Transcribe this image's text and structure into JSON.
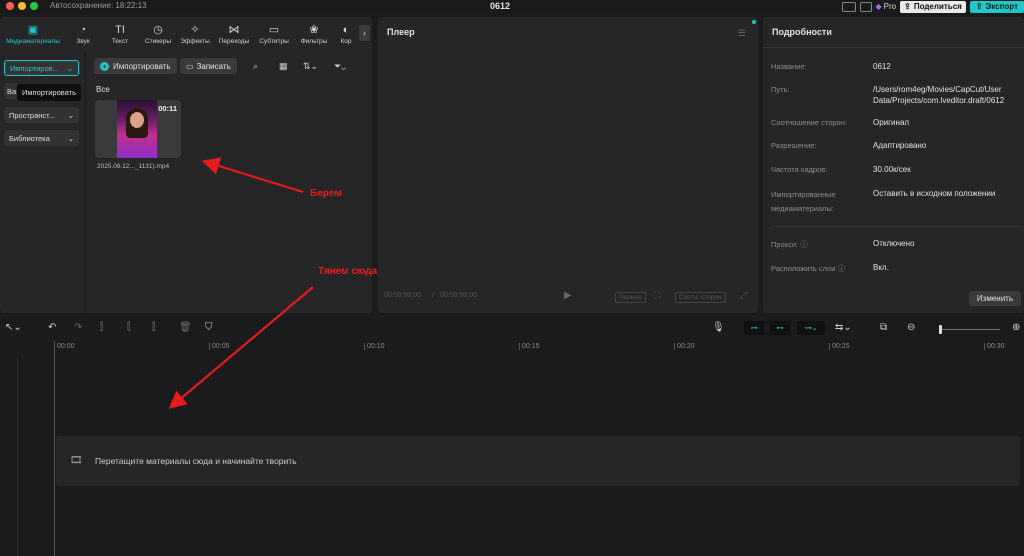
{
  "titlebar": {
    "autosave": "Автосохранение: 18:22:13",
    "project": "0612",
    "pro": "Pro",
    "share": "Поделиться",
    "export": "Экспорт"
  },
  "tabs": [
    {
      "label": "Медиаматериалы",
      "icon": "media-icon",
      "glyph": "▣"
    },
    {
      "label": "Звук",
      "icon": "audio-icon",
      "glyph": "◔"
    },
    {
      "label": "Текст",
      "icon": "text-icon",
      "glyph": "TI"
    },
    {
      "label": "Стикеры",
      "icon": "sticker-icon",
      "glyph": "◷"
    },
    {
      "label": "Эффекты",
      "icon": "effects-icon",
      "glyph": "✧"
    },
    {
      "label": "Переходы",
      "icon": "transitions-icon",
      "glyph": "⋈"
    },
    {
      "label": "Субтитры",
      "icon": "subtitles-icon",
      "glyph": "▭"
    },
    {
      "label": "Фильтры",
      "icon": "filters-icon",
      "glyph": "❀"
    },
    {
      "label": "Кор",
      "icon": "adjust-icon",
      "glyph": "◐"
    }
  ],
  "media": {
    "side": {
      "imported": "Импортиров...",
      "space": "Пространст...",
      "library": "Библиотека",
      "hidden_item": "Ва"
    },
    "tooltip": "Импортировать",
    "import_btn": "Импортировать",
    "record_btn": "Записать",
    "all_label": "Все",
    "clip": {
      "duration": "00:11",
      "name": "2025.06.12..._1131).mp4"
    }
  },
  "annotations": {
    "take": "Берем",
    "drag": "Тянем сюда"
  },
  "player": {
    "title": "Плеер",
    "time_current": "00:00:00:00",
    "time_total": "00:00:00:00",
    "full": "Полное",
    "ratio": "Соотн. сторон"
  },
  "details": {
    "title": "Подробности",
    "rows": [
      {
        "label": "Название:",
        "value": "0612"
      },
      {
        "label": "Путь:",
        "value": "/Users/rom4eg/Movies/CapCut/User Data/Projects/com.lveditor.draft/0612"
      },
      {
        "label": "Соотношение сторон:",
        "value": "Оригинал"
      },
      {
        "label": "Разрешение:",
        "value": "Адаптировано"
      },
      {
        "label": "Частота кадров:",
        "value": "30.00к/сек"
      },
      {
        "label": "Импортированные медиаматериалы:",
        "value": "Оставить в исходном положении"
      }
    ],
    "rows2": [
      {
        "label": "Прокси:",
        "value": "Отключено"
      },
      {
        "label": "Расположить слои",
        "value": "Вкл."
      }
    ],
    "change_btn": "Изменить"
  },
  "timeline": {
    "ticks": [
      "00:00",
      "00:05",
      "00:10",
      "00:15",
      "00:20",
      "00:25",
      "00:30"
    ],
    "drop_text": "Перетащите материалы сюда и начинайте творить"
  },
  "colors": {
    "accent": "#1fc7c8",
    "annotation": "#e41c1c",
    "panel": "#262628",
    "background": "#1b1b1d"
  }
}
